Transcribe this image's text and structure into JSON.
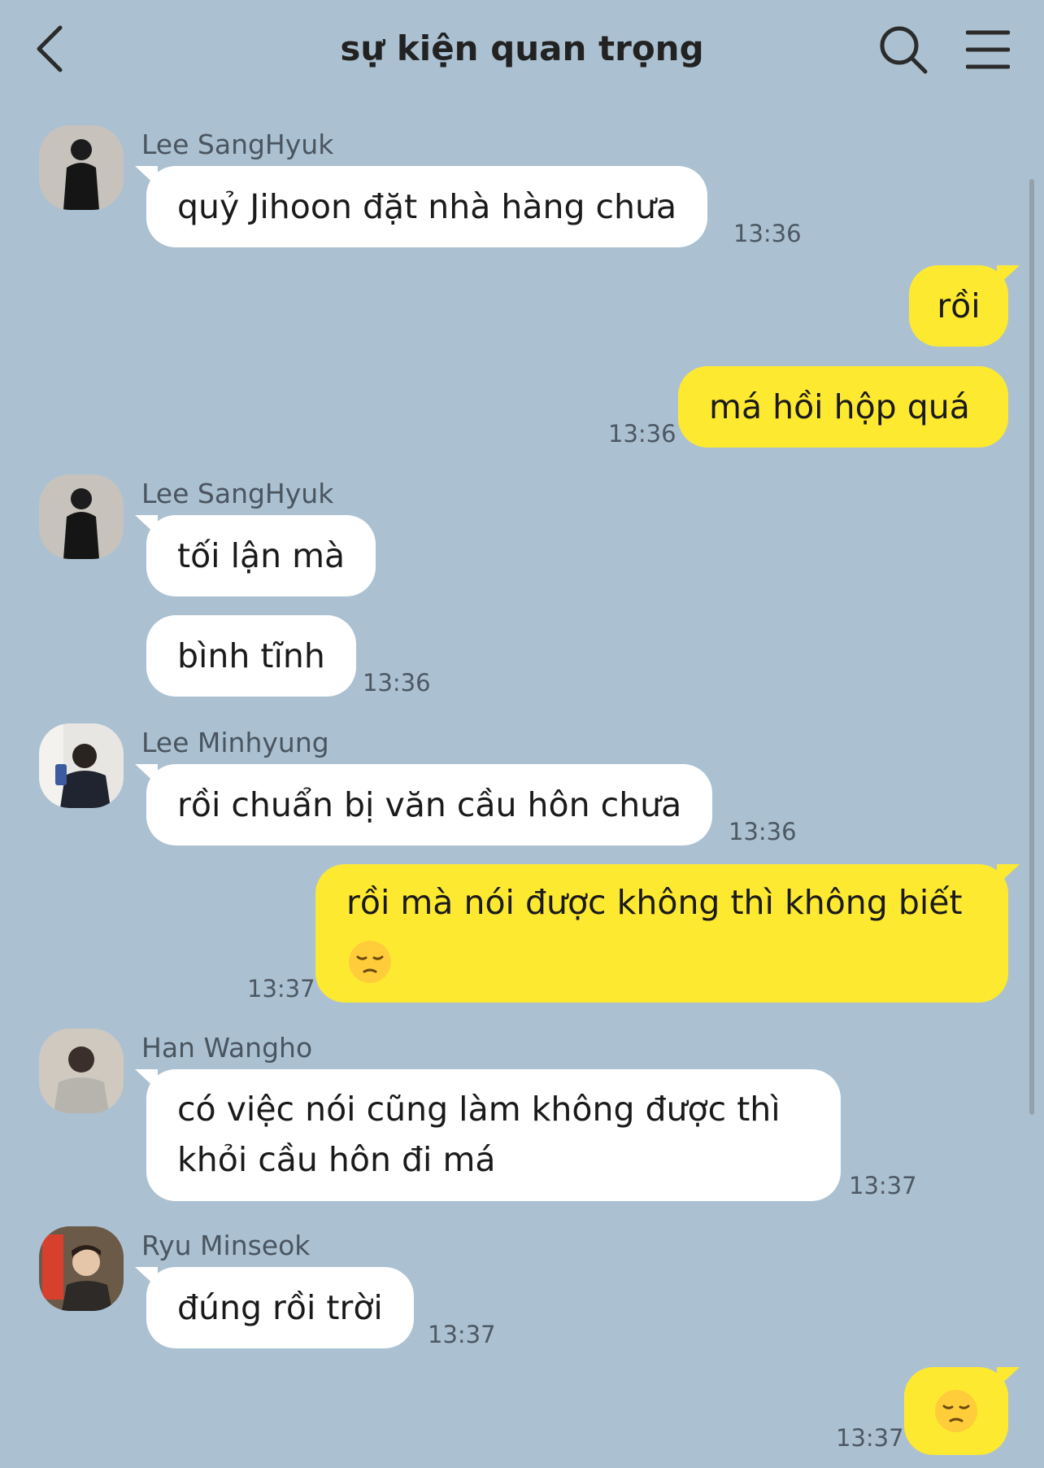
{
  "header": {
    "title": "sự kiện quan trọng",
    "icons": {
      "back": "chevron-left-icon",
      "search": "search-icon",
      "menu": "hamburger-menu-icon"
    }
  },
  "colors": {
    "background": "#abc1d1",
    "incoming_bubble": "#ffffff",
    "outgoing_bubble": "#fee931",
    "timestamp": "#4d5863"
  },
  "messages": [
    {
      "sender": "Lee SangHyuk",
      "avatar": "avatar-icon",
      "text": "quỷ Jihoon đặt nhà hàng chưa",
      "time": "13:36"
    },
    {
      "text": "rồi"
    },
    {
      "text": "má hồi hộp quá",
      "time": "13:36"
    },
    {
      "sender": "Lee SangHyuk",
      "avatar": "avatar-icon",
      "text": "tối lận mà"
    },
    {
      "text": "bình tĩnh",
      "time": "13:36"
    },
    {
      "sender": "Lee Minhyung",
      "avatar": "avatar-icon",
      "text": "rồi chuẩn bị văn cầu hôn chưa",
      "time": "13:36"
    },
    {
      "text_line1": "rồi mà nói được không thì không biết",
      "emoji": "pensive-face-emoji",
      "time": "13:37"
    },
    {
      "sender": "Han Wangho",
      "avatar": "avatar-icon",
      "text_line1": "có việc nói cũng làm không được thì",
      "text_line2": "khỏi cầu hôn đi má",
      "time": "13:37"
    },
    {
      "sender": "Ryu Minseok",
      "avatar": "avatar-icon",
      "text": "đúng rồi trời",
      "time": "13:37"
    },
    {
      "emoji": "pensive-face-emoji",
      "time": "13:37"
    }
  ]
}
